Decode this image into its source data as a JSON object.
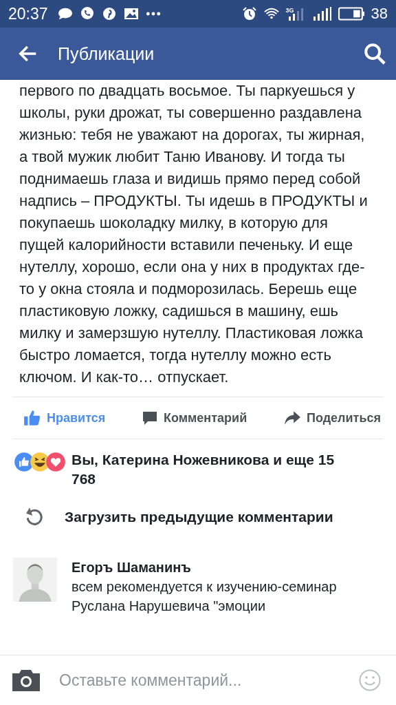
{
  "status_bar": {
    "time": "20:37",
    "network_label": "3G",
    "battery_percent": "38"
  },
  "app_bar": {
    "title": "Публикации"
  },
  "post": {
    "text": "первого по двадцать восьмое. Ты паркуешься у школы, руки дрожат, ты совершенно раздавлена жизнью: тебя не уважают на дорогах, ты жирная, а твой мужик любит Таню Иванову. И тогда ты поднимаешь глаза и видишь прямо перед собой надпись – ПРОДУКТЫ. Ты идешь в ПРОДУКТЫ и покупаешь шоколадку милку, в которую для пущей калорийности вставили печеньку. И еще нутеллу, хорошо, если она у них в продуктах где-то у окна стояла и подморозилась. Берешь еще пластиковую ложку, садишься в машину, ешь милку и замерзшую нутеллу. Пластиковая ложка быстро ломается, тогда нутеллу можно есть ключом. И как-то… отпускает."
  },
  "actions": [
    {
      "kind": "like",
      "label": "Нравится",
      "selected": true
    },
    {
      "kind": "comment",
      "label": "Комментарий",
      "selected": false
    },
    {
      "kind": "share",
      "label": "Поделиться",
      "selected": false
    }
  ],
  "reactions": {
    "summary": "Вы, Катерина Ножевникова и еще 15 768"
  },
  "load_previous": "Загрузить предыдущие комментарии",
  "comments": [
    {
      "author": "Егоръ Шаманинъ",
      "text": "всем рекомендуется к изучению-семинар Руслана Нарушевича \"эмоции"
    }
  ],
  "composer": {
    "placeholder": "Оставьте комментарий..."
  }
}
